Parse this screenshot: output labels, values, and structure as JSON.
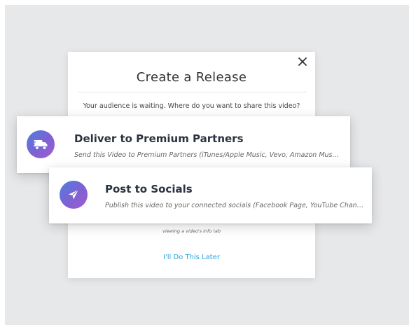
{
  "modal": {
    "title": "Create a Release",
    "subtitle": "Your audience is waiting. Where do you want to share this video?",
    "hint": "viewing a video's info tab",
    "later_label": "I'll Do This Later",
    "close_icon": "close-icon"
  },
  "options": [
    {
      "icon": "delivery-truck-icon",
      "title": "Deliver to Premium Partners",
      "description": "Send this Video to Premium Partners (iTunes/Apple Music, Vevo, Amazon Music, and more)"
    },
    {
      "icon": "paper-plane-icon",
      "title": "Post to Socials",
      "description": "Publish this video to your connected socials (Facebook Page, YouTube Channel, and more)"
    }
  ],
  "colors": {
    "accent_link": "#2aa3d8",
    "icon_gradient_start": "#4f7fde",
    "icon_gradient_end": "#a35ad0",
    "backdrop": "#e7e8ea"
  }
}
